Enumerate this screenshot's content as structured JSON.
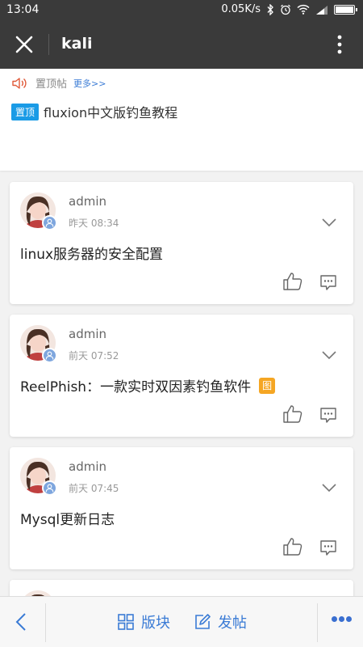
{
  "status_bar": {
    "time": "13:04",
    "network_speed": "0.05K/s",
    "battery_level": 1.0
  },
  "title_bar": {
    "title": "kali"
  },
  "pinned": {
    "label": "置顶帖",
    "more_label": "更多>>",
    "badge": "置顶",
    "post_title": "fluxion中文版钓鱼教程"
  },
  "posts": [
    {
      "author": "admin",
      "time": "昨天 08:34",
      "title": "linux服务器的安全配置",
      "has_image": false
    },
    {
      "author": "admin",
      "time": "前天 07:52",
      "title": "ReelPhish：一款实时双因素钓鱼软件",
      "has_image": true,
      "image_badge": "图"
    },
    {
      "author": "admin",
      "time": "前天 07:45",
      "title": "Mysql更新日志",
      "has_image": false
    }
  ],
  "bottom_bar": {
    "boards_label": "版块",
    "post_label": "发帖"
  },
  "colors": {
    "header_bg": "#3a3a3a",
    "accent": "#3a7bd5",
    "pin_badge": "#1a9be6",
    "image_badge": "#f5a623",
    "speaker_icon": "#e05a3a"
  }
}
